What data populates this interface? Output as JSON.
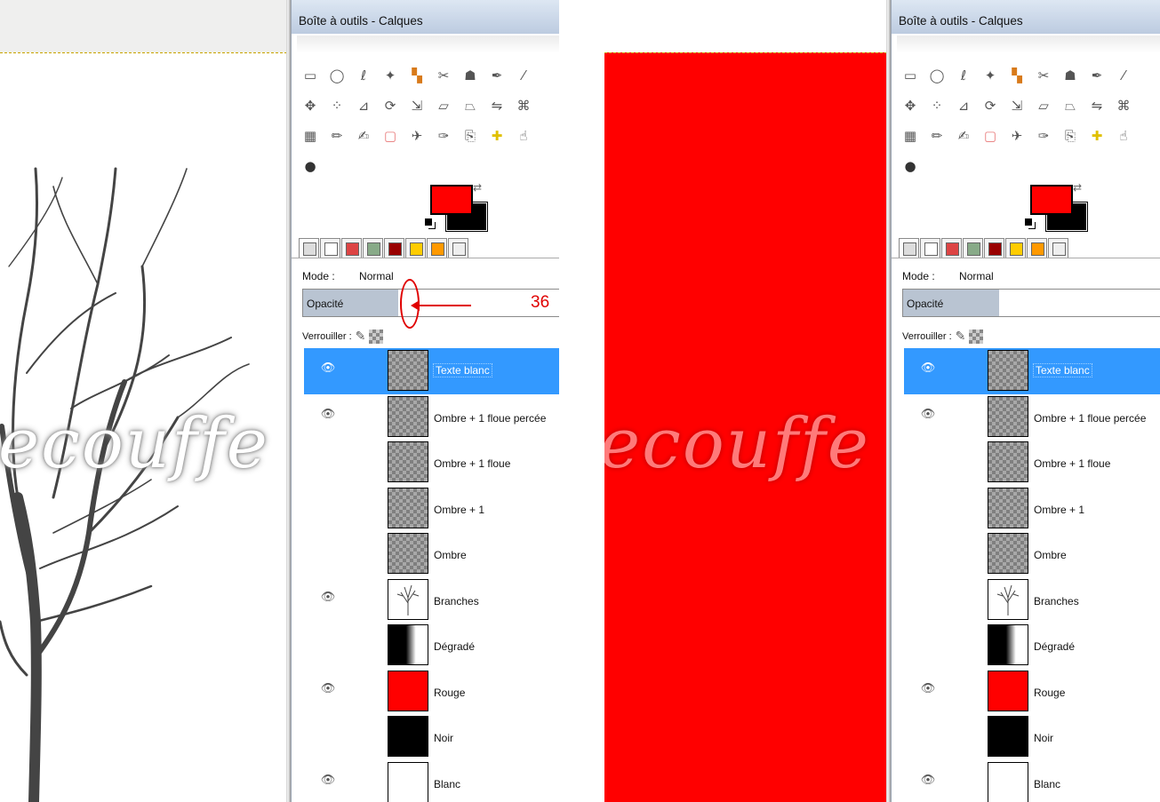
{
  "window_title": "Boîte à outils - Calques",
  "watermark_text": "ecouffe",
  "mode_label": "Mode :",
  "mode_value": "Normal",
  "opacity_label": "Opacité",
  "opacity_value_annotation": "36",
  "lock_label": "Verrouiller :",
  "colors": {
    "foreground": "#ff0000",
    "background": "#000000",
    "selection": "#3399ff",
    "annotation": "#e00000"
  },
  "tools": [
    [
      "rect-select-icon",
      "ellipse-select-icon",
      "free-select-icon",
      "fuzzy-select-icon",
      "color-select-icon",
      "scissors-icon",
      "foreground-select-icon",
      "paths-icon",
      "color-picker-icon"
    ],
    [
      "move-icon",
      "align-icon",
      "crop-icon",
      "rotate-icon",
      "scale-icon",
      "shear-icon",
      "perspective-icon",
      "flip-icon",
      "cage-icon"
    ],
    [
      "blend-icon",
      "pencil-icon",
      "paintbrush-icon",
      "eraser-icon",
      "airbrush-icon",
      "ink-icon",
      "clone-icon",
      "heal-icon",
      "smudge-icon"
    ],
    [
      "dodge-burn-icon"
    ]
  ],
  "dock_tabs": [
    "layers-tab-icon",
    "channels-tab-icon",
    "paths-tab-icon",
    "undo-tab-icon",
    "gradients-tab-icon",
    "patterns-tab-icon",
    "brushes-tab-icon",
    "fonts-tab-icon"
  ],
  "left_panel": {
    "opacity_fraction": 0.36,
    "layers": [
      {
        "name": "Texte blanc",
        "visible": true,
        "thumb": "checker",
        "selected": true
      },
      {
        "name": "Ombre + 1 floue percée",
        "visible": true,
        "thumb": "checker",
        "selected": false
      },
      {
        "name": "Ombre + 1 floue",
        "visible": false,
        "thumb": "checker",
        "selected": false
      },
      {
        "name": "Ombre + 1",
        "visible": false,
        "thumb": "checker",
        "selected": false
      },
      {
        "name": "Ombre",
        "visible": false,
        "thumb": "checker",
        "selected": false
      },
      {
        "name": "Branches",
        "visible": true,
        "thumb": "tree",
        "selected": false
      },
      {
        "name": "Dégradé",
        "visible": false,
        "thumb": "grad",
        "selected": false
      },
      {
        "name": "Rouge",
        "visible": true,
        "thumb": "red",
        "selected": false
      },
      {
        "name": "Noir",
        "visible": false,
        "thumb": "black",
        "selected": false
      },
      {
        "name": "Blanc",
        "visible": true,
        "thumb": "white",
        "selected": false
      }
    ]
  },
  "right_panel": {
    "opacity_fraction": 0.36,
    "layers": [
      {
        "name": "Texte blanc",
        "visible": true,
        "thumb": "checker",
        "selected": true
      },
      {
        "name": "Ombre + 1 floue percée",
        "visible": true,
        "thumb": "checker",
        "selected": false
      },
      {
        "name": "Ombre + 1 floue",
        "visible": false,
        "thumb": "checker",
        "selected": false
      },
      {
        "name": "Ombre + 1",
        "visible": false,
        "thumb": "checker",
        "selected": false
      },
      {
        "name": "Ombre",
        "visible": false,
        "thumb": "checker",
        "selected": false
      },
      {
        "name": "Branches",
        "visible": false,
        "thumb": "tree",
        "selected": false
      },
      {
        "name": "Dégradé",
        "visible": false,
        "thumb": "grad",
        "selected": false
      },
      {
        "name": "Rouge",
        "visible": true,
        "thumb": "red",
        "selected": false
      },
      {
        "name": "Noir",
        "visible": false,
        "thumb": "black",
        "selected": false
      },
      {
        "name": "Blanc",
        "visible": true,
        "thumb": "white",
        "selected": false
      }
    ]
  }
}
